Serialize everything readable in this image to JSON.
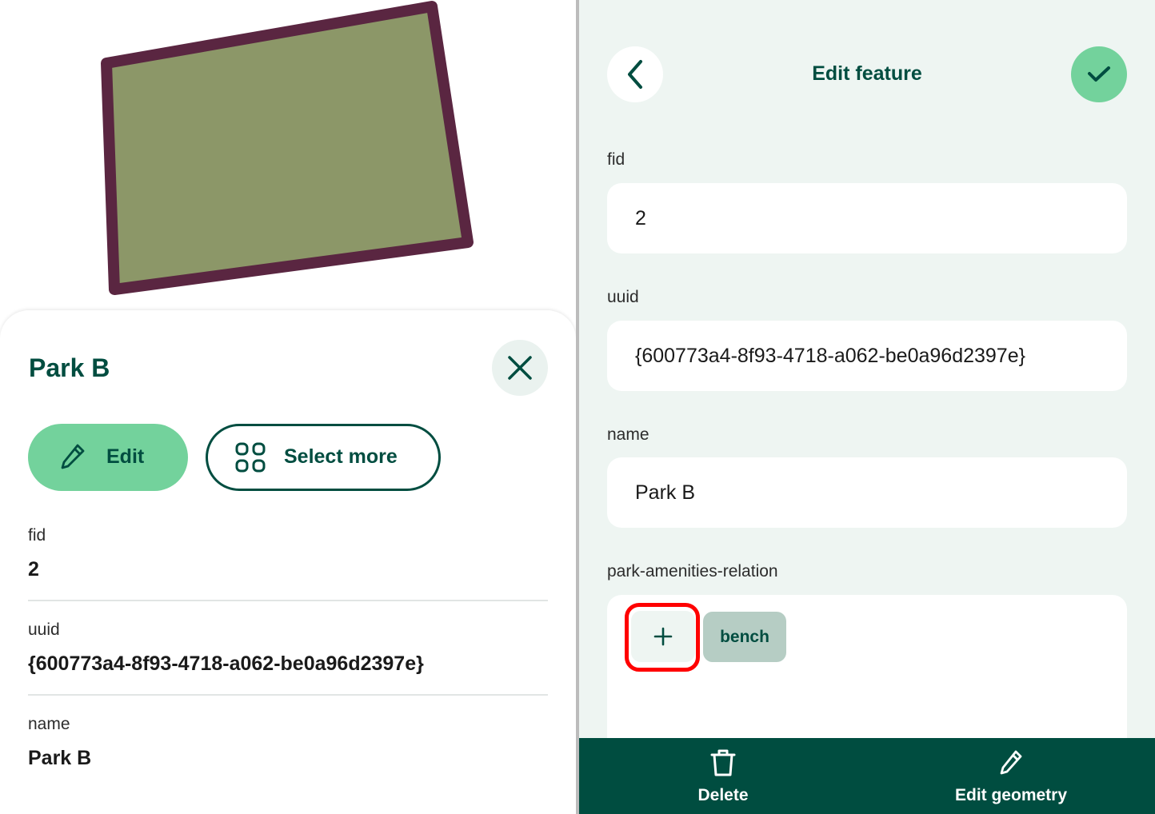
{
  "feature_panel": {
    "title": "Park B",
    "edit_label": "Edit",
    "select_more_label": "Select more",
    "attributes": [
      {
        "key": "fid",
        "value": "2"
      },
      {
        "key": "uuid",
        "value": "{600773a4-8f93-4718-a062-be0a96d2397e}"
      },
      {
        "key": "name",
        "value": "Park B"
      }
    ]
  },
  "map": {
    "polygon_fill": "#8c9768",
    "polygon_stroke": "#5a2641"
  },
  "edit_form": {
    "title": "Edit feature",
    "fields": [
      {
        "label": "fid",
        "value": "2"
      },
      {
        "label": "uuid",
        "value": "{600773a4-8f93-4718-a062-be0a96d2397e}"
      },
      {
        "label": "name",
        "value": "Park B"
      }
    ],
    "relation": {
      "label": "park-amenities-relation",
      "add_icon": "plus-icon",
      "items": [
        "bench"
      ]
    },
    "bottom_bar": {
      "delete_label": "Delete",
      "edit_geometry_label": "Edit geometry"
    }
  },
  "colors": {
    "brand_dark": "#004d40",
    "accent_green": "#73d29c",
    "highlight_red": "#ff0000"
  }
}
